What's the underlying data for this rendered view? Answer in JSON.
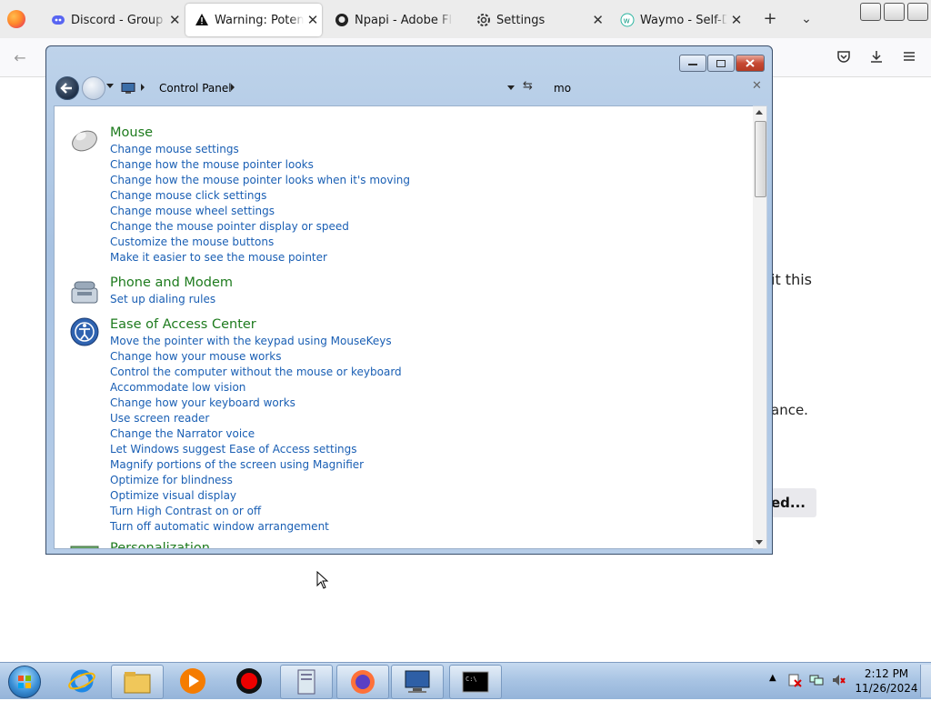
{
  "browser": {
    "tabs": [
      {
        "label": "Discord - Group Chat",
        "icon": "discord-icon",
        "active": false
      },
      {
        "label": "Warning: Potential Security Risk",
        "icon": "warning-icon",
        "active": true
      },
      {
        "label": "Npapi - Adobe Flash",
        "icon": "github-icon",
        "active": false
      },
      {
        "label": "Settings",
        "icon": "gear-icon",
        "active": false
      },
      {
        "label": "Waymo - Self-Driving",
        "icon": "waymo-icon",
        "active": false
      }
    ],
    "page_fragments": {
      "line1": "it this",
      "line2": "ance.",
      "button": "ed..."
    }
  },
  "control_panel": {
    "breadcrumb": "Control Panel",
    "search_value": "mo",
    "categories": [
      {
        "title": "Mouse",
        "icon": "mouse-icon",
        "links": [
          "Change mouse settings",
          "Change how the mouse pointer looks",
          "Change how the mouse pointer looks when it's moving",
          "Change mouse click settings",
          "Change mouse wheel settings",
          "Change the mouse pointer display or speed",
          "Customize the mouse buttons",
          "Make it easier to see the mouse pointer"
        ]
      },
      {
        "title": "Phone and Modem",
        "icon": "phone-modem-icon",
        "links": [
          "Set up dialing rules"
        ]
      },
      {
        "title": "Ease of Access Center",
        "icon": "ease-of-access-icon",
        "links": [
          "Move the pointer with the keypad using MouseKeys",
          "Change how your mouse works",
          "Control the computer without the mouse or keyboard",
          "Accommodate low vision",
          "Change how your keyboard works",
          "Use screen reader",
          "Change the Narrator voice",
          "Let Windows suggest Ease of Access settings",
          "Magnify portions of the screen using Magnifier",
          "Optimize for blindness",
          "Optimize visual display",
          "Turn High Contrast on or off",
          "Turn off automatic window arrangement"
        ]
      },
      {
        "title": "Personalization",
        "icon": "personalization-icon",
        "links": []
      }
    ]
  },
  "taskbar": {
    "items": [
      "internet-explorer-icon",
      "explorer-icon",
      "media-player-icon",
      "record-icon",
      "file-icon",
      "firefox-icon",
      "control-panel-icon",
      "cmd-icon"
    ],
    "clock_time": "2:12 PM",
    "clock_date": "11/26/2024"
  },
  "colors": {
    "link": "#1a5fb4",
    "category_title": "#1e7b1e",
    "window_frame": "#a7c2e2"
  }
}
